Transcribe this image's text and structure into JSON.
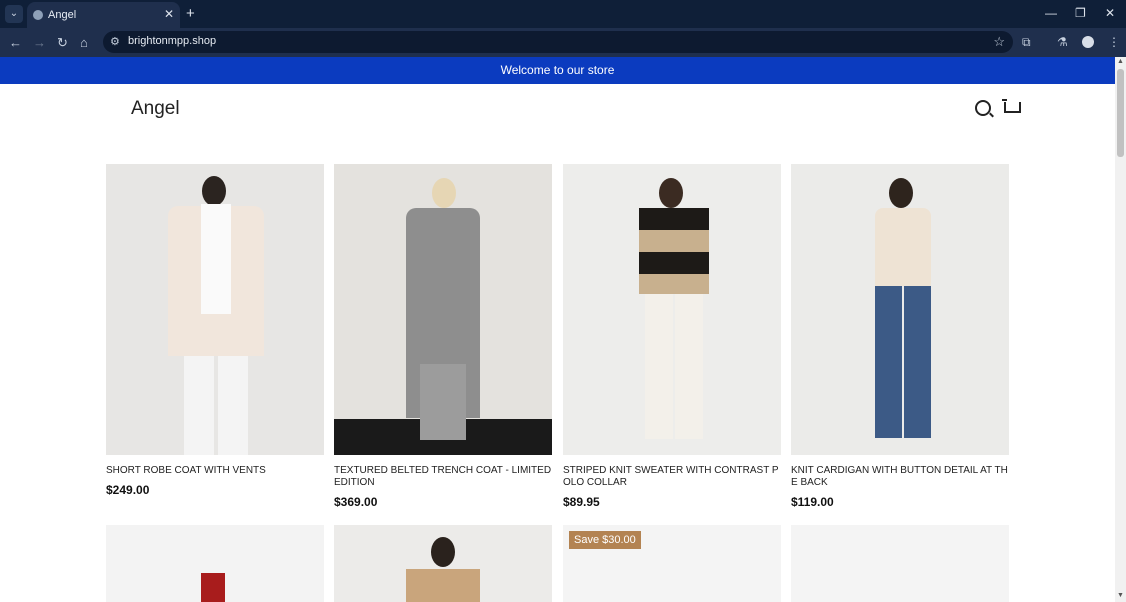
{
  "browser": {
    "tab_title": "Angel",
    "url": "brightonmpp.shop"
  },
  "page": {
    "announcement": "Welcome to our store",
    "logo": "Angel"
  },
  "products": [
    {
      "title": "SHORT ROBE COAT WITH VENTS",
      "price": "$249.00"
    },
    {
      "title": "TEXTURED BELTED TRENCH COAT - LIMITED EDITION",
      "price": "$369.00"
    },
    {
      "title": "STRIPED KNIT SWEATER WITH CONTRAST POLO COLLAR",
      "price": "$89.95"
    },
    {
      "title": "KNIT CARDIGAN WITH BUTTON DETAIL AT THE BACK",
      "price": "$119.00"
    }
  ],
  "badges": {
    "save": "Save $30.00"
  },
  "colors": {
    "announcement_bg": "#0b3bbf",
    "badge_bg": "#b38352"
  }
}
